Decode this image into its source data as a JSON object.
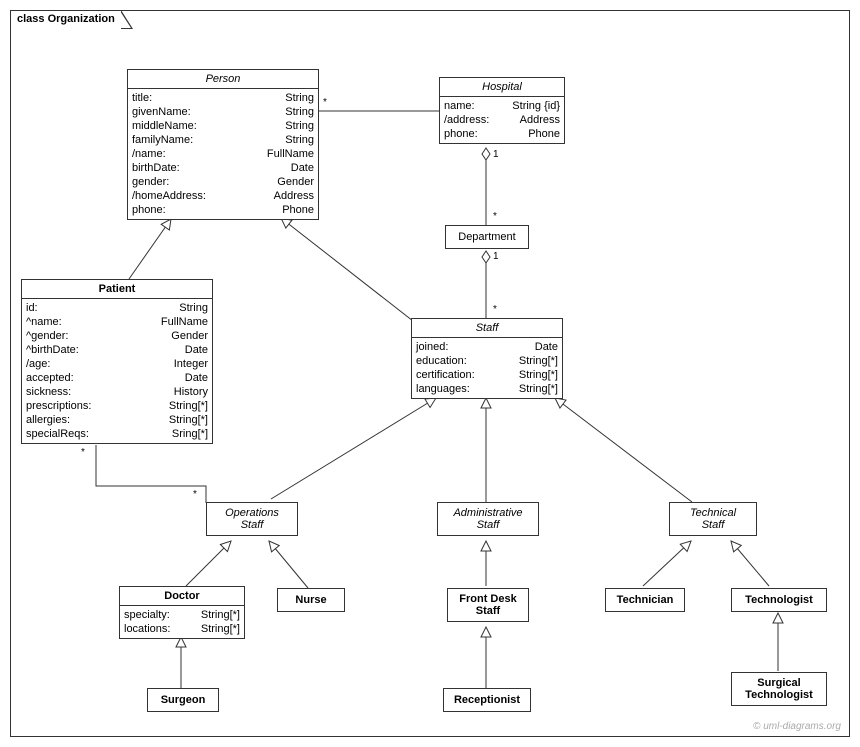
{
  "frame": {
    "label": "class Organization"
  },
  "person": {
    "title": "Person",
    "attrs": [
      [
        "title:",
        "String"
      ],
      [
        "givenName:",
        "String"
      ],
      [
        "middleName:",
        "String"
      ],
      [
        "familyName:",
        "String"
      ],
      [
        "/name:",
        "FullName"
      ],
      [
        "birthDate:",
        "Date"
      ],
      [
        "gender:",
        "Gender"
      ],
      [
        "/homeAddress:",
        "Address"
      ],
      [
        "phone:",
        "Phone"
      ]
    ]
  },
  "hospital": {
    "title": "Hospital",
    "attrs": [
      [
        "name:",
        "String {id}"
      ],
      [
        "/address:",
        "Address"
      ],
      [
        "phone:",
        "Phone"
      ]
    ]
  },
  "department": {
    "title": "Department"
  },
  "patient": {
    "title": "Patient",
    "attrs": [
      [
        "id:",
        "String"
      ],
      [
        "^name:",
        "FullName"
      ],
      [
        "^gender:",
        "Gender"
      ],
      [
        "^birthDate:",
        "Date"
      ],
      [
        "/age:",
        "Integer"
      ],
      [
        "accepted:",
        "Date"
      ],
      [
        "sickness:",
        "History"
      ],
      [
        "prescriptions:",
        "String[*]"
      ],
      [
        "allergies:",
        "String[*]"
      ],
      [
        "specialReqs:",
        "Sring[*]"
      ]
    ]
  },
  "staff": {
    "title": "Staff",
    "attrs": [
      [
        "joined:",
        "Date"
      ],
      [
        "education:",
        "String[*]"
      ],
      [
        "certification:",
        "String[*]"
      ],
      [
        "languages:",
        "String[*]"
      ]
    ]
  },
  "opsStaff": {
    "title": "Operations",
    "title2": "Staff"
  },
  "adminStaff": {
    "title": "Administrative",
    "title2": "Staff"
  },
  "techStaff": {
    "title": "Technical",
    "title2": "Staff"
  },
  "doctor": {
    "title": "Doctor",
    "attrs": [
      [
        "specialty:",
        "String[*]"
      ],
      [
        "locations:",
        "String[*]"
      ]
    ]
  },
  "nurse": {
    "title": "Nurse"
  },
  "frontDesk": {
    "title": "Front Desk",
    "title2": "Staff"
  },
  "technician": {
    "title": "Technician"
  },
  "technologist": {
    "title": "Technologist"
  },
  "surgeon": {
    "title": "Surgeon"
  },
  "receptionist": {
    "title": "Receptionist"
  },
  "surgTech": {
    "title": "Surgical",
    "title2": "Technologist"
  },
  "mult": {
    "personHosp": "*",
    "hospDept1": "1",
    "hospDeptStar": "*",
    "deptStaff1": "1",
    "deptStaffStar": "*",
    "opsPatientTop": "*",
    "opsPatientBottom": "*"
  },
  "watermark": "© uml-diagrams.org"
}
